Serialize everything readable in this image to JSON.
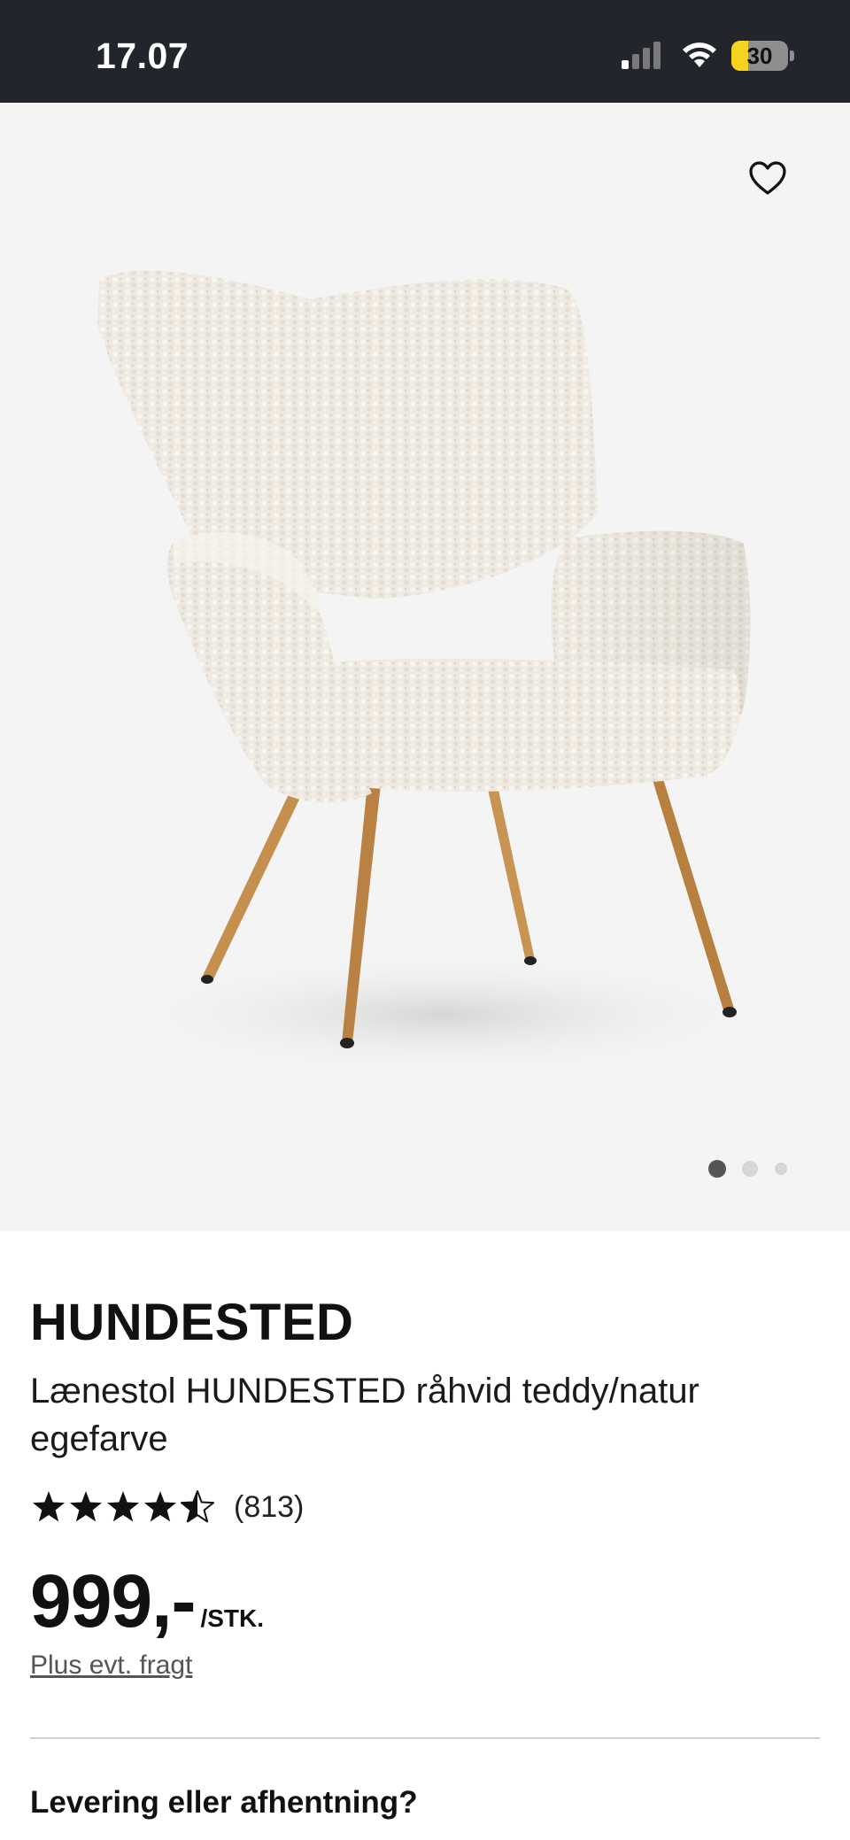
{
  "status_bar": {
    "time": "17.07",
    "battery_level": "30",
    "battery_fraction": 0.3,
    "icons": [
      "signal-icon",
      "wifi-icon",
      "battery-icon"
    ]
  },
  "gallery": {
    "image": "chair-photo",
    "favorite_icon": "heart-icon",
    "pages": 3,
    "active_page": 1
  },
  "product": {
    "name": "HUNDESTED",
    "description": "Lænestol HUNDESTED råhvid teddy/natur egefarve",
    "rating": 4.5,
    "review_count": "(813)",
    "price": "999,-",
    "unit": "/STK.",
    "shipping_note": "Plus evt. fragt"
  },
  "delivery": {
    "heading": "Levering eller afhentning?"
  },
  "colors": {
    "status_bar_bg": "#22252b",
    "gallery_bg": "#f4f4f4",
    "battery_fill": "#f5d321",
    "text": "#111111"
  }
}
